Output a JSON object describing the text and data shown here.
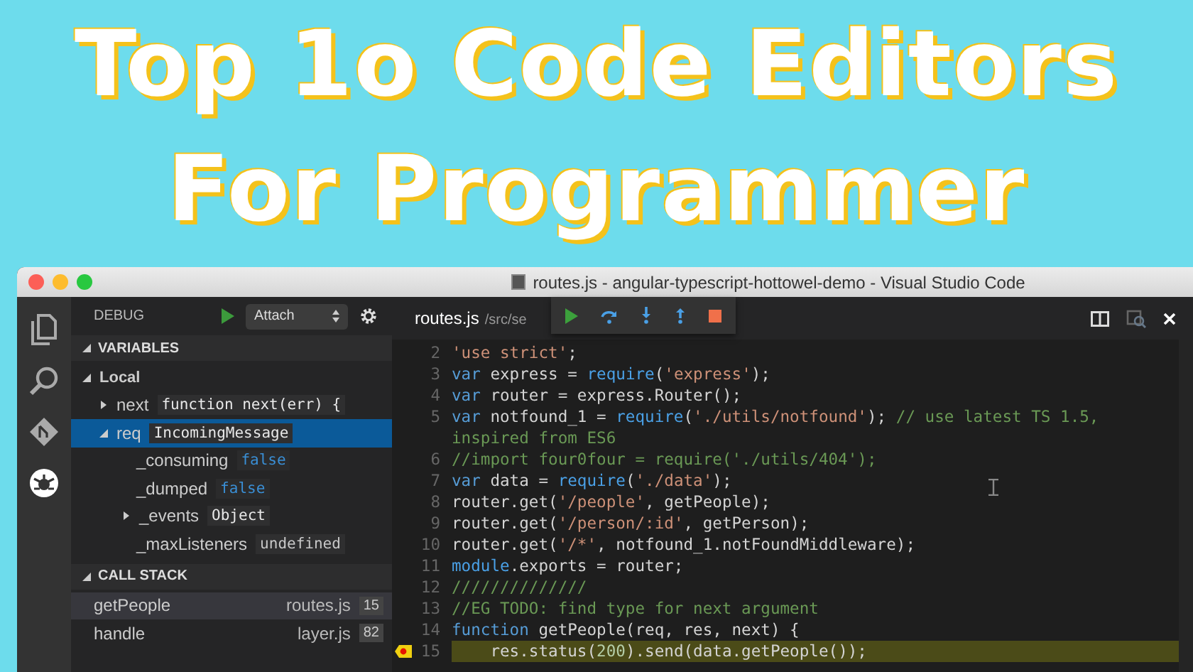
{
  "banner": {
    "lines": [
      "Top 1o Code Editors",
      "For Programmer"
    ]
  },
  "window": {
    "title": "routes.js - angular-typescript-hottowel-demo - Visual Studio Code"
  },
  "activity_bar": {
    "items": [
      {
        "kind": "files",
        "selected": false
      },
      {
        "kind": "search",
        "selected": false
      },
      {
        "kind": "git",
        "selected": false
      },
      {
        "kind": "debug",
        "selected": true
      }
    ]
  },
  "sidebar": {
    "label": "DEBUG",
    "configuration": "Attach",
    "variables": {
      "header": "VARIABLES",
      "expanded": true,
      "scope": {
        "name": "Local",
        "expanded": true
      },
      "items": [
        {
          "name": "next",
          "value": "function next(err) {",
          "kind": "object",
          "expanded": false,
          "selected": false
        },
        {
          "name": "req",
          "value": "IncomingMessage",
          "kind": "object",
          "expanded": true,
          "selected": true,
          "children": [
            {
              "name": "_consuming",
              "value": "false",
              "kind": "boolean",
              "selected": false
            },
            {
              "name": "_dumped",
              "value": "false",
              "kind": "boolean",
              "selected": false
            },
            {
              "name": "_events",
              "value": "Object",
              "kind": "object",
              "expanded": false,
              "selected": false
            },
            {
              "name": "_maxListeners",
              "value": "undefined",
              "kind": "plain",
              "selected": false
            }
          ]
        }
      ]
    },
    "call_stack": {
      "header": "CALL STACK",
      "expanded": true,
      "frames": [
        {
          "name": "getPeople",
          "file": "routes.js",
          "line": "15",
          "selected": true
        },
        {
          "name": "handle",
          "file": "layer.js",
          "line": "82",
          "selected": false
        }
      ]
    }
  },
  "editor": {
    "tab": {
      "name": "routes.js",
      "path": "/src/se"
    },
    "code": [
      {
        "number": "2",
        "current": false,
        "rows": [
          [
            {
              "kind": "str",
              "text": "'use strict'"
            },
            {
              "kind": "plain",
              "text": ";"
            }
          ]
        ]
      },
      {
        "number": "3",
        "current": false,
        "rows": [
          [
            {
              "kind": "kw",
              "text": "var"
            },
            {
              "kind": "plain",
              "text": " express = "
            },
            {
              "kind": "fn",
              "text": "require"
            },
            {
              "kind": "plain",
              "text": "("
            },
            {
              "kind": "str",
              "text": "'express'"
            },
            {
              "kind": "plain",
              "text": ");"
            }
          ]
        ]
      },
      {
        "number": "4",
        "current": false,
        "rows": [
          [
            {
              "kind": "kw",
              "text": "var"
            },
            {
              "kind": "plain",
              "text": " router = express.Router();"
            }
          ]
        ]
      },
      {
        "number": "5",
        "current": false,
        "rows": [
          [
            {
              "kind": "kw",
              "text": "var"
            },
            {
              "kind": "plain",
              "text": " notfound_1 = "
            },
            {
              "kind": "fn",
              "text": "require"
            },
            {
              "kind": "plain",
              "text": "("
            },
            {
              "kind": "str",
              "text": "'./utils/notfound'"
            },
            {
              "kind": "plain",
              "text": "); "
            },
            {
              "kind": "comment",
              "text": "// use latest TS 1.5,"
            }
          ],
          [
            {
              "kind": "comment",
              "text": "inspired from ES6"
            }
          ]
        ]
      },
      {
        "number": "6",
        "current": false,
        "rows": [
          [
            {
              "kind": "comment",
              "text": "//import four0four = require('./utils/404');"
            }
          ]
        ]
      },
      {
        "number": "7",
        "current": false,
        "rows": [
          [
            {
              "kind": "kw",
              "text": "var"
            },
            {
              "kind": "plain",
              "text": " data = "
            },
            {
              "kind": "fn",
              "text": "require"
            },
            {
              "kind": "plain",
              "text": "("
            },
            {
              "kind": "str",
              "text": "'./data'"
            },
            {
              "kind": "plain",
              "text": ");"
            }
          ]
        ]
      },
      {
        "number": "8",
        "current": false,
        "rows": [
          [
            {
              "kind": "plain",
              "text": "router.get("
            },
            {
              "kind": "str",
              "text": "'/people'"
            },
            {
              "kind": "plain",
              "text": ", getPeople);"
            }
          ]
        ]
      },
      {
        "number": "9",
        "current": false,
        "rows": [
          [
            {
              "kind": "plain",
              "text": "router.get("
            },
            {
              "kind": "str",
              "text": "'/person/:id'"
            },
            {
              "kind": "plain",
              "text": ", getPerson);"
            }
          ]
        ]
      },
      {
        "number": "10",
        "current": false,
        "rows": [
          [
            {
              "kind": "plain",
              "text": "router.get("
            },
            {
              "kind": "str",
              "text": "'/*'"
            },
            {
              "kind": "plain",
              "text": ", notfound_1.notFoundMiddleware);"
            }
          ]
        ]
      },
      {
        "number": "11",
        "current": false,
        "rows": [
          [
            {
              "kind": "fn",
              "text": "module"
            },
            {
              "kind": "plain",
              "text": ".exports = router;"
            }
          ]
        ]
      },
      {
        "number": "12",
        "current": false,
        "rows": [
          [
            {
              "kind": "comment",
              "text": "//////////////"
            }
          ]
        ]
      },
      {
        "number": "13",
        "current": false,
        "rows": [
          [
            {
              "kind": "comment",
              "text": "//EG TODO: find type for next argument"
            }
          ]
        ]
      },
      {
        "number": "14",
        "current": false,
        "rows": [
          [
            {
              "kind": "kw",
              "text": "function"
            },
            {
              "kind": "plain",
              "text": " getPeople(req, res, next) {"
            }
          ]
        ]
      },
      {
        "number": "15",
        "current": true,
        "rows": [
          [
            {
              "kind": "plain",
              "text": "    res.status("
            },
            {
              "kind": "num",
              "text": "200"
            },
            {
              "kind": "plain",
              "text": ").send(data.getPeople());"
            }
          ]
        ]
      }
    ]
  }
}
